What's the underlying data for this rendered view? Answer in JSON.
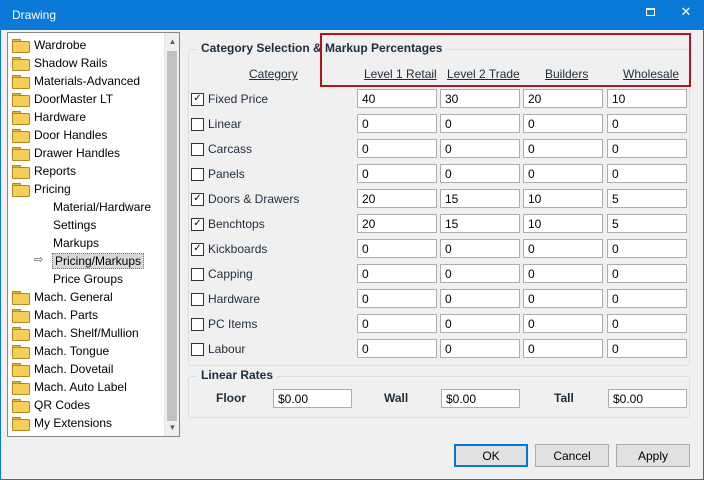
{
  "window": {
    "title": "Drawing",
    "maximize_icon": "maximize-icon",
    "close_glyph": "✕"
  },
  "tree": {
    "items": [
      {
        "label": "Wardrobe",
        "type": "folder"
      },
      {
        "label": "Shadow Rails",
        "type": "folder"
      },
      {
        "label": "Materials-Advanced",
        "type": "folder"
      },
      {
        "label": "DoorMaster LT",
        "type": "folder"
      },
      {
        "label": "Hardware",
        "type": "folder"
      },
      {
        "label": "Door Handles",
        "type": "folder"
      },
      {
        "label": "Drawer Handles",
        "type": "folder"
      },
      {
        "label": "Reports",
        "type": "folder"
      },
      {
        "label": "Pricing",
        "type": "folder"
      },
      {
        "label": "Material/Hardware",
        "type": "child"
      },
      {
        "label": "Settings",
        "type": "child"
      },
      {
        "label": "Markups",
        "type": "child"
      },
      {
        "label": "Pricing/Markups",
        "type": "child",
        "selected": true
      },
      {
        "label": "Price Groups",
        "type": "child"
      },
      {
        "label": "Mach. General",
        "type": "folder"
      },
      {
        "label": "Mach. Parts",
        "type": "folder"
      },
      {
        "label": "Mach. Shelf/Mullion",
        "type": "folder"
      },
      {
        "label": "Mach. Tongue",
        "type": "folder"
      },
      {
        "label": "Mach. Dovetail",
        "type": "folder"
      },
      {
        "label": "Mach. Auto Label",
        "type": "folder"
      },
      {
        "label": "QR Codes",
        "type": "folder"
      },
      {
        "label": "My Extensions",
        "type": "folder"
      }
    ],
    "selected_arrow": "⇨"
  },
  "markups": {
    "title": "Category Selection & Markup Percentages",
    "columns": [
      "Category",
      "Level 1 Retail",
      "Level 2 Trade",
      "Builders",
      "Wholesale"
    ],
    "rows": [
      {
        "label": "Fixed Price",
        "checked": true,
        "values": [
          "40",
          "30",
          "20",
          "10"
        ]
      },
      {
        "label": "Linear",
        "checked": false,
        "values": [
          "0",
          "0",
          "0",
          "0"
        ]
      },
      {
        "label": "Carcass",
        "checked": false,
        "values": [
          "0",
          "0",
          "0",
          "0"
        ]
      },
      {
        "label": "Panels",
        "checked": false,
        "values": [
          "0",
          "0",
          "0",
          "0"
        ]
      },
      {
        "label": "Doors & Drawers",
        "checked": true,
        "values": [
          "20",
          "15",
          "10",
          "5"
        ]
      },
      {
        "label": "Benchtops",
        "checked": true,
        "values": [
          "20",
          "15",
          "10",
          "5"
        ]
      },
      {
        "label": "Kickboards",
        "checked": true,
        "values": [
          "0",
          "0",
          "0",
          "0"
        ]
      },
      {
        "label": "Capping",
        "checked": false,
        "values": [
          "0",
          "0",
          "0",
          "0"
        ]
      },
      {
        "label": "Hardware",
        "checked": false,
        "values": [
          "0",
          "0",
          "0",
          "0"
        ]
      },
      {
        "label": "PC Items",
        "checked": false,
        "values": [
          "0",
          "0",
          "0",
          "0"
        ]
      },
      {
        "label": "Labour",
        "checked": false,
        "values": [
          "0",
          "0",
          "0",
          "0"
        ]
      }
    ],
    "check_glyph": "✓"
  },
  "linear_rates": {
    "title": "Linear Rates",
    "floor_label": "Floor",
    "floor_value": "$0.00",
    "wall_label": "Wall",
    "wall_value": "$0.00",
    "tall_label": "Tall",
    "tall_value": "$0.00"
  },
  "buttons": {
    "ok": "OK",
    "cancel": "Cancel",
    "apply": "Apply"
  },
  "colors": {
    "titlebar": "#0a78d7",
    "highlight": "#b4121e",
    "folder": "#f5cd5b"
  }
}
